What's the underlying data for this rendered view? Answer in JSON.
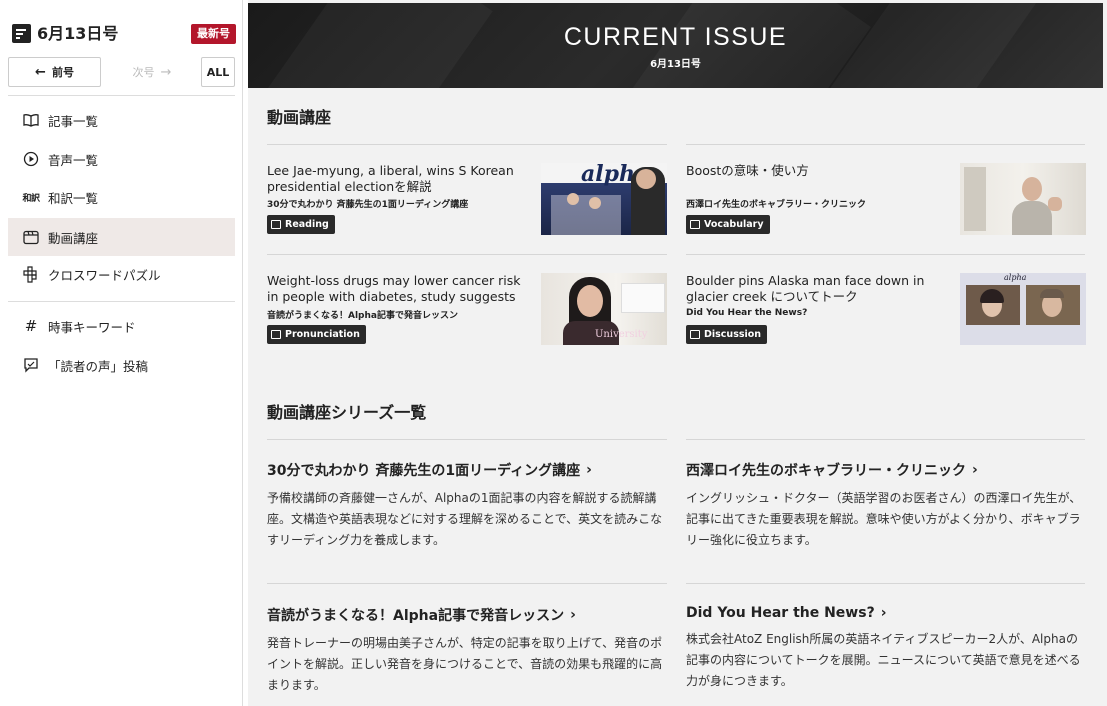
{
  "sidebar": {
    "issue_title": "6月13日号",
    "latest_badge": "最新号",
    "prev_label": "前号",
    "next_label": "次号",
    "all_label": "ALL",
    "menu": [
      {
        "label": "記事一覧",
        "icon": "book-icon"
      },
      {
        "label": "音声一覧",
        "icon": "play-circle-icon"
      },
      {
        "label": "和訳一覧",
        "icon": "translation-icon",
        "icon_text": "和訳"
      },
      {
        "label": "動画講座",
        "icon": "video-icon"
      },
      {
        "label": "クロスワードパズル",
        "icon": "crossword-icon"
      },
      {
        "label": "時事キーワード",
        "icon": "hash-icon",
        "icon_text": "#"
      },
      {
        "label": "「読者の声」投稿",
        "icon": "chat-icon"
      }
    ]
  },
  "banner": {
    "title": "CURRENT ISSUE",
    "subtitle": "6月13日号"
  },
  "videos_section": {
    "title": "動画講座",
    "cards": [
      {
        "title": "Lee Jae-myung, a liberal, wins S Korean presidential electionを解説",
        "series": "30分で丸わかり 斉藤先生の1面リーディング講座",
        "badge": "Reading",
        "thumb_text": "alpha"
      },
      {
        "title": "Boostの意味・使い方",
        "series": "西澤ロイ先生のボキャブラリー・クリニック",
        "badge": "Vocabulary"
      },
      {
        "title": "Weight-loss drugs may lower cancer risk in people with diabetes, study suggests を解説",
        "series": "音読がうまくなる！Alpha記事で発音レッスン",
        "badge": "Pronunciation",
        "thumb_text": "University"
      },
      {
        "title": "Boulder pins Alaska man face down in glacier creek についてトーク",
        "series": "Did You Hear the News?",
        "badge": "Discussion",
        "thumb_text": "alpha"
      }
    ]
  },
  "series_section": {
    "title": "動画講座シリーズ一覧",
    "items": [
      {
        "title": "30分で丸わかり 斉藤先生の1面リーディング講座",
        "desc": "予備校講師の斉藤健一さんが、Alphaの1面記事の内容を解説する読解講座。文構造や英語表現などに対する理解を深めることで、英文を読みこなすリーディング力を養成します。"
      },
      {
        "title": "西澤ロイ先生のボキャブラリー・クリニック",
        "desc": "イングリッシュ・ドクター（英語学習のお医者さん）の西澤ロイ先生が、記事に出てきた重要表現を解説。意味や使い方がよく分かり、ボキャブラリー強化に役立ちます。"
      },
      {
        "title": "音読がうまくなる！Alpha記事で発音レッスン",
        "desc": "発音トレーナーの明場由美子さんが、特定の記事を取り上げて、発音のポイントを解説。正しい発音を身につけることで、音読の効果も飛躍的に高まります。"
      },
      {
        "title": "Did You Hear the News?",
        "desc": "株式会社AtoZ English所属の英語ネイティブスピーカー2人が、Alphaの記事の内容についてトークを展開。ニュースについて英語で意見を述べる力が身につきます。"
      }
    ]
  },
  "colors": {
    "accent_red": "#b3162b",
    "active_bg": "#efe9e7",
    "main_bg": "#f2f2f2",
    "badge_bg": "#2a2a2a"
  }
}
